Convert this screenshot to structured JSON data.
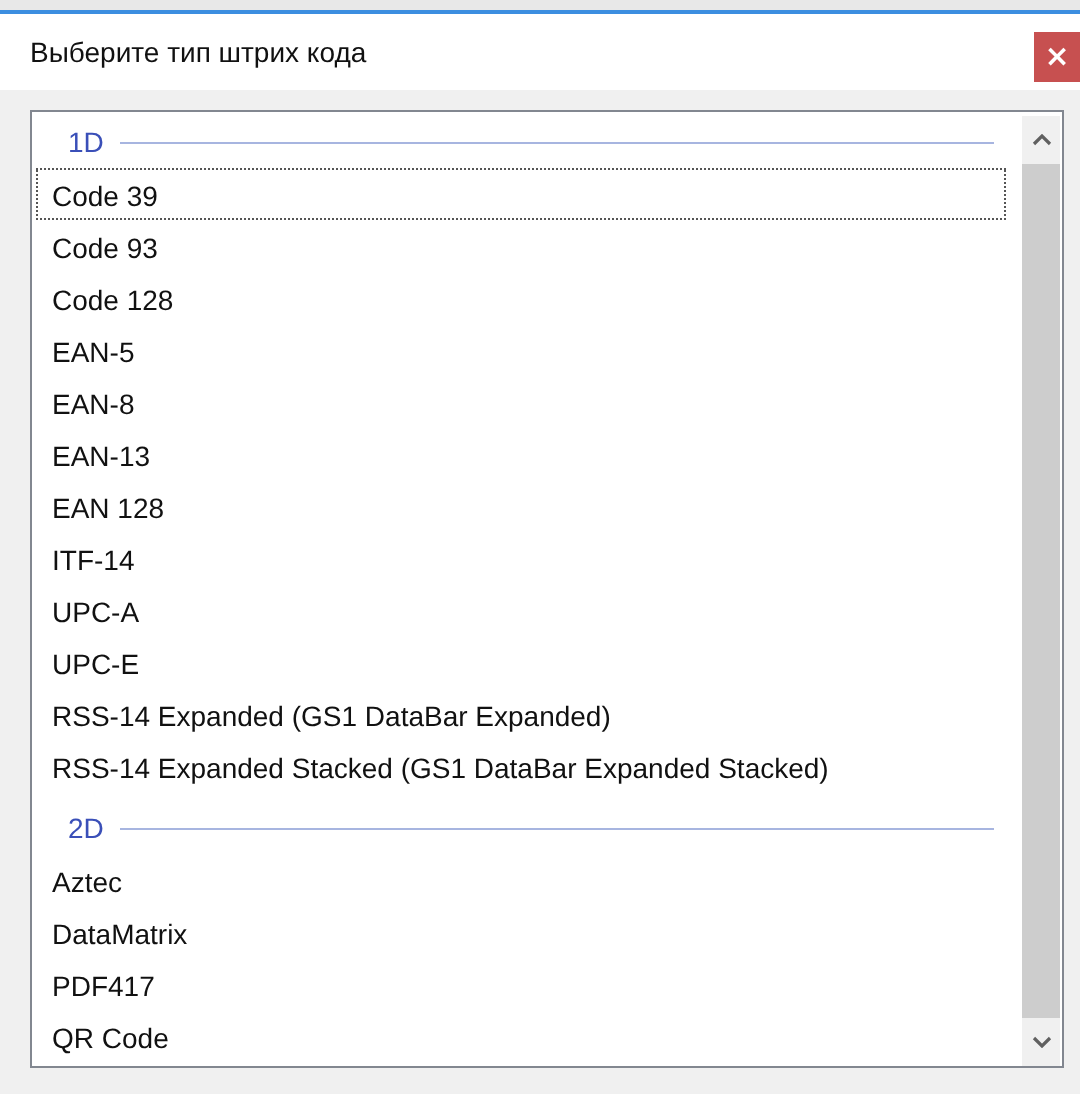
{
  "dialog": {
    "title": "Выберите тип штрих кода",
    "close": "×"
  },
  "groups": [
    {
      "label": "1D",
      "items": [
        {
          "label": "Code 39",
          "selected": true
        },
        {
          "label": "Code 93",
          "selected": false
        },
        {
          "label": "Code 128",
          "selected": false
        },
        {
          "label": "EAN-5",
          "selected": false
        },
        {
          "label": "EAN-8",
          "selected": false
        },
        {
          "label": "EAN-13",
          "selected": false
        },
        {
          "label": "EAN 128",
          "selected": false
        },
        {
          "label": "ITF-14",
          "selected": false
        },
        {
          "label": "UPC-A",
          "selected": false
        },
        {
          "label": "UPC-E",
          "selected": false
        },
        {
          "label": "RSS-14 Expanded (GS1 DataBar Expanded)",
          "selected": false
        },
        {
          "label": "RSS-14 Expanded Stacked (GS1 DataBar Expanded Stacked)",
          "selected": false
        }
      ]
    },
    {
      "label": "2D",
      "items": [
        {
          "label": "Aztec",
          "selected": false
        },
        {
          "label": "DataMatrix",
          "selected": false
        },
        {
          "label": "PDF417",
          "selected": false
        },
        {
          "label": "QR Code",
          "selected": false
        }
      ]
    }
  ]
}
